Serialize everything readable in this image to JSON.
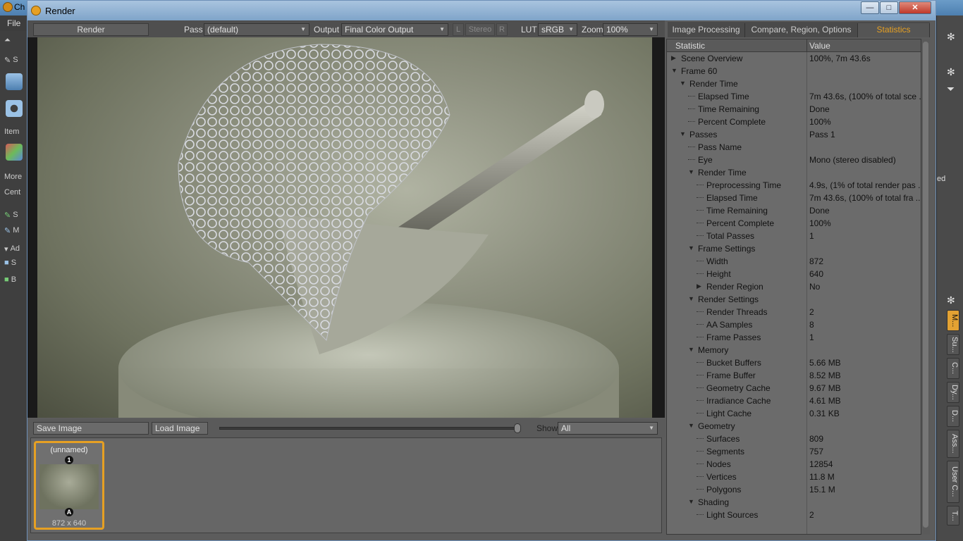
{
  "background_app": {
    "title": "Ch",
    "menu_file": "File",
    "toolbar_labels": [
      "S",
      "Item",
      "More",
      "Cent",
      "S",
      "M",
      "Ad",
      "S",
      "B"
    ],
    "right_fragment": "ed",
    "vertical_tabs": [
      "M...",
      "Su...",
      "C...",
      "Dy...",
      "D...",
      "Ass...",
      "User C...",
      "T..."
    ]
  },
  "window": {
    "title": "Render",
    "controls": {
      "minimize": "—",
      "maximize": "□",
      "close": "✕"
    }
  },
  "toolbar": {
    "render_button": "Render",
    "pass_label": "Pass",
    "pass_value": "(default)",
    "output_label": "Output",
    "output_value": "Final Color Output",
    "stereo_l": "L",
    "stereo_label": "Stereo",
    "stereo_r": "R",
    "lut_label": "LUT",
    "lut_value": "sRGB",
    "zoom_label": "Zoom",
    "zoom_value": "100%"
  },
  "image_bar": {
    "save_image": "Save Image",
    "load_image": "Load Image",
    "show_label": "Show",
    "show_value": "All"
  },
  "thumbnail": {
    "name": "(unnamed)",
    "size": "872 x 640",
    "badge_top": "1",
    "badge_bottom": "A"
  },
  "tabs": [
    {
      "label": "Image Processing",
      "active": false
    },
    {
      "label": "Compare, Region, Options",
      "active": false
    },
    {
      "label": "Statistics",
      "active": true
    }
  ],
  "statistics": {
    "header_statistic": "Statistic",
    "header_value": "Value",
    "rows": [
      {
        "level": 0,
        "toggle": "collapsed",
        "label": "Scene Overview",
        "value": "100%, 7m 43.6s"
      },
      {
        "level": 0,
        "toggle": "expanded",
        "label": "Frame 60",
        "value": ""
      },
      {
        "level": 1,
        "toggle": "expanded",
        "label": "Render Time",
        "value": ""
      },
      {
        "level": 2,
        "toggle": "none",
        "label": "Elapsed Time",
        "value": "7m 43.6s, (100% of total sce ..."
      },
      {
        "level": 2,
        "toggle": "none",
        "label": "Time Remaining",
        "value": "Done"
      },
      {
        "level": 2,
        "toggle": "none",
        "label": "Percent Complete",
        "value": "100%"
      },
      {
        "level": 1,
        "toggle": "expanded",
        "label": "Passes",
        "value": "Pass 1"
      },
      {
        "level": 2,
        "toggle": "none",
        "label": "Pass Name",
        "value": ""
      },
      {
        "level": 2,
        "toggle": "none",
        "label": "Eye",
        "value": "Mono (stereo disabled)"
      },
      {
        "level": 2,
        "toggle": "expanded",
        "label": "Render Time",
        "value": ""
      },
      {
        "level": 3,
        "toggle": "none",
        "label": "Preprocessing Time",
        "value": "4.9s, (1% of total render pas ..."
      },
      {
        "level": 3,
        "toggle": "none",
        "label": "Elapsed Time",
        "value": "7m 43.6s, (100% of total fra ..."
      },
      {
        "level": 3,
        "toggle": "none",
        "label": "Time Remaining",
        "value": "Done"
      },
      {
        "level": 3,
        "toggle": "none",
        "label": "Percent Complete",
        "value": "100%"
      },
      {
        "level": 3,
        "toggle": "none",
        "label": "Total Passes",
        "value": "1"
      },
      {
        "level": 2,
        "toggle": "expanded",
        "label": "Frame Settings",
        "value": ""
      },
      {
        "level": 3,
        "toggle": "none",
        "label": "Width",
        "value": "872"
      },
      {
        "level": 3,
        "toggle": "none",
        "label": "Height",
        "value": "640"
      },
      {
        "level": 3,
        "toggle": "collapsed",
        "label": "Render Region",
        "value": "No"
      },
      {
        "level": 2,
        "toggle": "expanded",
        "label": "Render Settings",
        "value": ""
      },
      {
        "level": 3,
        "toggle": "none",
        "label": "Render Threads",
        "value": "2"
      },
      {
        "level": 3,
        "toggle": "none",
        "label": "AA Samples",
        "value": "8"
      },
      {
        "level": 3,
        "toggle": "none",
        "label": "Frame Passes",
        "value": "1"
      },
      {
        "level": 2,
        "toggle": "expanded",
        "label": "Memory",
        "value": ""
      },
      {
        "level": 3,
        "toggle": "none",
        "label": "Bucket Buffers",
        "value": "5.66 MB"
      },
      {
        "level": 3,
        "toggle": "none",
        "label": "Frame Buffer",
        "value": "8.52 MB"
      },
      {
        "level": 3,
        "toggle": "none",
        "label": "Geometry Cache",
        "value": "9.67 MB"
      },
      {
        "level": 3,
        "toggle": "none",
        "label": "Irradiance Cache",
        "value": "4.61 MB"
      },
      {
        "level": 3,
        "toggle": "none",
        "label": "Light Cache",
        "value": "0.31 KB"
      },
      {
        "level": 2,
        "toggle": "expanded",
        "label": "Geometry",
        "value": ""
      },
      {
        "level": 3,
        "toggle": "none",
        "label": "Surfaces",
        "value": "809"
      },
      {
        "level": 3,
        "toggle": "none",
        "label": "Segments",
        "value": "757"
      },
      {
        "level": 3,
        "toggle": "none",
        "label": "Nodes",
        "value": "12854"
      },
      {
        "level": 3,
        "toggle": "none",
        "label": "Vertices",
        "value": "11.8 M"
      },
      {
        "level": 3,
        "toggle": "none",
        "label": "Polygons",
        "value": "15.1 M"
      },
      {
        "level": 2,
        "toggle": "expanded",
        "label": "Shading",
        "value": ""
      },
      {
        "level": 3,
        "toggle": "none",
        "label": "Light Sources",
        "value": "2"
      }
    ]
  },
  "colors": {
    "accent": "#e6a023",
    "panel": "#6b6b6b",
    "toolbar": "#4f4f4f"
  }
}
